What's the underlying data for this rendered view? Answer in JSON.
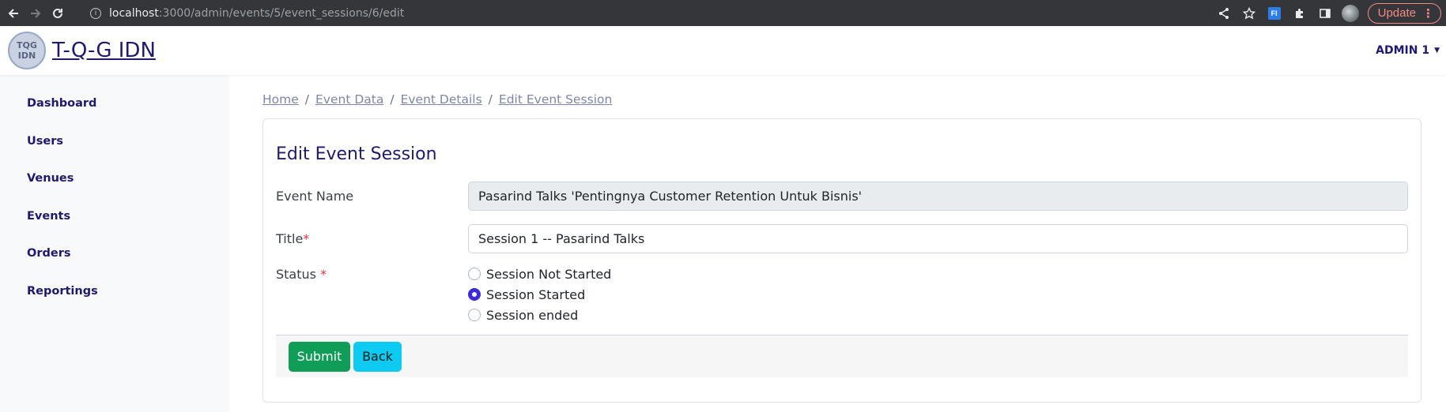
{
  "browser": {
    "url_host": "localhost",
    "url_path": ":3000/admin/events/5/event_sessions/6/edit",
    "update_label": "Update",
    "extension_label": "FI"
  },
  "header": {
    "logo_text_top": "TQG",
    "logo_text_bottom": "IDN",
    "brand": "T-Q-G IDN",
    "user_menu": "ADMIN 1"
  },
  "sidebar": {
    "items": [
      {
        "label": "Dashboard"
      },
      {
        "label": "Users"
      },
      {
        "label": "Venues"
      },
      {
        "label": "Events"
      },
      {
        "label": "Orders"
      },
      {
        "label": "Reportings"
      }
    ]
  },
  "breadcrumb": [
    {
      "label": "Home"
    },
    {
      "label": "Event Data"
    },
    {
      "label": "Event Details"
    },
    {
      "label": "Edit Event Session"
    }
  ],
  "form": {
    "title": "Edit Event Session",
    "event_name_label": "Event Name",
    "event_name_value": "Pasarind Talks 'Pentingnya Customer Retention Untuk Bisnis'",
    "title_label": "Title",
    "title_value": "Session 1 -- Pasarind Talks",
    "status_label": "Status ",
    "required_mark": "*",
    "status_options": [
      {
        "label": "Session Not Started",
        "checked": false
      },
      {
        "label": "Session Started",
        "checked": true
      },
      {
        "label": "Session ended",
        "checked": false
      }
    ],
    "submit_label": "Submit",
    "back_label": "Back"
  }
}
